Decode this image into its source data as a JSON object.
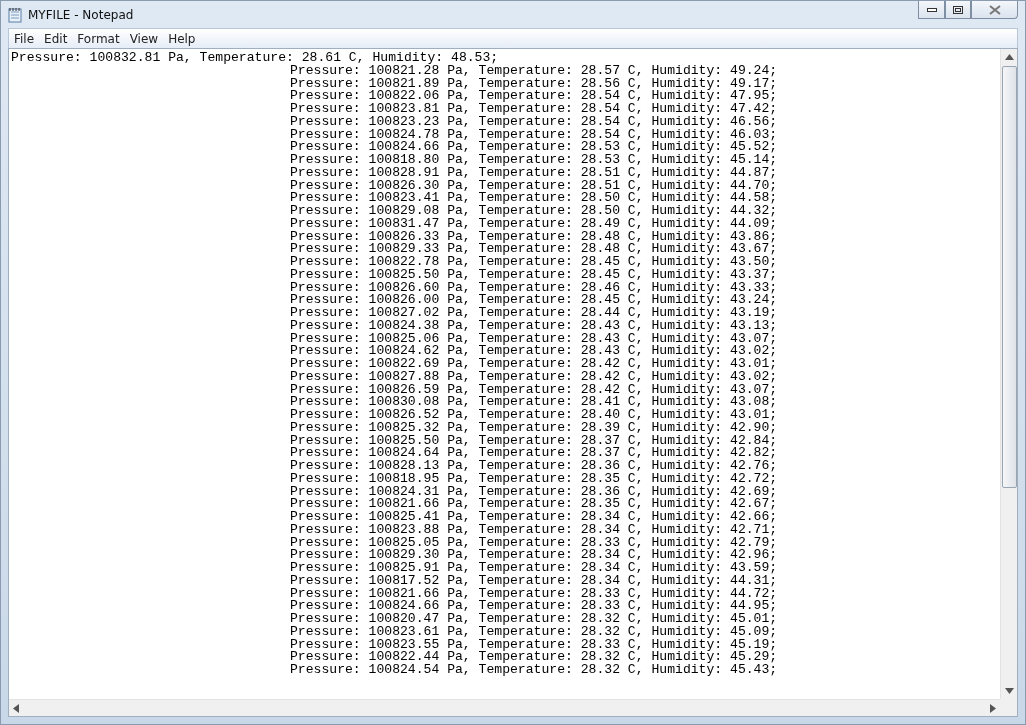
{
  "window": {
    "title": "MYFILE - Notepad"
  },
  "menu": [
    "File",
    "Edit",
    "Format",
    "View",
    "Help"
  ],
  "document": {
    "first_line": "Pressure: 100832.81 Pa, Temperature: 28.61 C, Humidity: 48.53;",
    "lines": [
      "Pressure: 100821.28 Pa, Temperature: 28.57 C, Humidity: 49.24;",
      "Pressure: 100821.89 Pa, Temperature: 28.56 C, Humidity: 49.17;",
      "Pressure: 100822.06 Pa, Temperature: 28.54 C, Humidity: 47.95;",
      "Pressure: 100823.81 Pa, Temperature: 28.54 C, Humidity: 47.42;",
      "Pressure: 100823.23 Pa, Temperature: 28.54 C, Humidity: 46.56;",
      "Pressure: 100824.78 Pa, Temperature: 28.54 C, Humidity: 46.03;",
      "Pressure: 100824.66 Pa, Temperature: 28.53 C, Humidity: 45.52;",
      "Pressure: 100818.80 Pa, Temperature: 28.53 C, Humidity: 45.14;",
      "Pressure: 100828.91 Pa, Temperature: 28.51 C, Humidity: 44.87;",
      "Pressure: 100826.30 Pa, Temperature: 28.51 C, Humidity: 44.70;",
      "Pressure: 100823.41 Pa, Temperature: 28.50 C, Humidity: 44.58;",
      "Pressure: 100829.08 Pa, Temperature: 28.50 C, Humidity: 44.32;",
      "Pressure: 100831.47 Pa, Temperature: 28.49 C, Humidity: 44.09;",
      "Pressure: 100826.33 Pa, Temperature: 28.48 C, Humidity: 43.86;",
      "Pressure: 100829.33 Pa, Temperature: 28.48 C, Humidity: 43.67;",
      "Pressure: 100822.78 Pa, Temperature: 28.45 C, Humidity: 43.50;",
      "Pressure: 100825.50 Pa, Temperature: 28.45 C, Humidity: 43.37;",
      "Pressure: 100826.60 Pa, Temperature: 28.46 C, Humidity: 43.33;",
      "Pressure: 100826.00 Pa, Temperature: 28.45 C, Humidity: 43.24;",
      "Pressure: 100827.02 Pa, Temperature: 28.44 C, Humidity: 43.19;",
      "Pressure: 100824.38 Pa, Temperature: 28.43 C, Humidity: 43.13;",
      "Pressure: 100825.06 Pa, Temperature: 28.43 C, Humidity: 43.07;",
      "Pressure: 100824.62 Pa, Temperature: 28.43 C, Humidity: 43.02;",
      "Pressure: 100822.69 Pa, Temperature: 28.42 C, Humidity: 43.01;",
      "Pressure: 100827.88 Pa, Temperature: 28.42 C, Humidity: 43.02;",
      "Pressure: 100826.59 Pa, Temperature: 28.42 C, Humidity: 43.07;",
      "Pressure: 100830.08 Pa, Temperature: 28.41 C, Humidity: 43.08;",
      "Pressure: 100826.52 Pa, Temperature: 28.40 C, Humidity: 43.01;",
      "Pressure: 100825.32 Pa, Temperature: 28.39 C, Humidity: 42.90;",
      "Pressure: 100825.50 Pa, Temperature: 28.37 C, Humidity: 42.84;",
      "Pressure: 100824.64 Pa, Temperature: 28.37 C, Humidity: 42.82;",
      "Pressure: 100828.13 Pa, Temperature: 28.36 C, Humidity: 42.76;",
      "Pressure: 100818.95 Pa, Temperature: 28.35 C, Humidity: 42.72;",
      "Pressure: 100824.31 Pa, Temperature: 28.36 C, Humidity: 42.69;",
      "Pressure: 100821.66 Pa, Temperature: 28.35 C, Humidity: 42.67;",
      "Pressure: 100825.41 Pa, Temperature: 28.34 C, Humidity: 42.66;",
      "Pressure: 100823.88 Pa, Temperature: 28.34 C, Humidity: 42.71;",
      "Pressure: 100825.05 Pa, Temperature: 28.33 C, Humidity: 42.79;",
      "Pressure: 100829.30 Pa, Temperature: 28.34 C, Humidity: 42.96;",
      "Pressure: 100825.91 Pa, Temperature: 28.34 C, Humidity: 43.59;",
      "Pressure: 100817.52 Pa, Temperature: 28.34 C, Humidity: 44.31;",
      "Pressure: 100821.66 Pa, Temperature: 28.33 C, Humidity: 44.72;",
      "Pressure: 100824.66 Pa, Temperature: 28.33 C, Humidity: 44.95;",
      "Pressure: 100820.47 Pa, Temperature: 28.32 C, Humidity: 45.01;",
      "Pressure: 100823.61 Pa, Temperature: 28.32 C, Humidity: 45.09;",
      "Pressure: 100823.55 Pa, Temperature: 28.33 C, Humidity: 45.19;",
      "Pressure: 100822.44 Pa, Temperature: 28.32 C, Humidity: 45.29;",
      "Pressure: 100824.54 Pa, Temperature: 28.32 C, Humidity: 45.43;"
    ]
  }
}
